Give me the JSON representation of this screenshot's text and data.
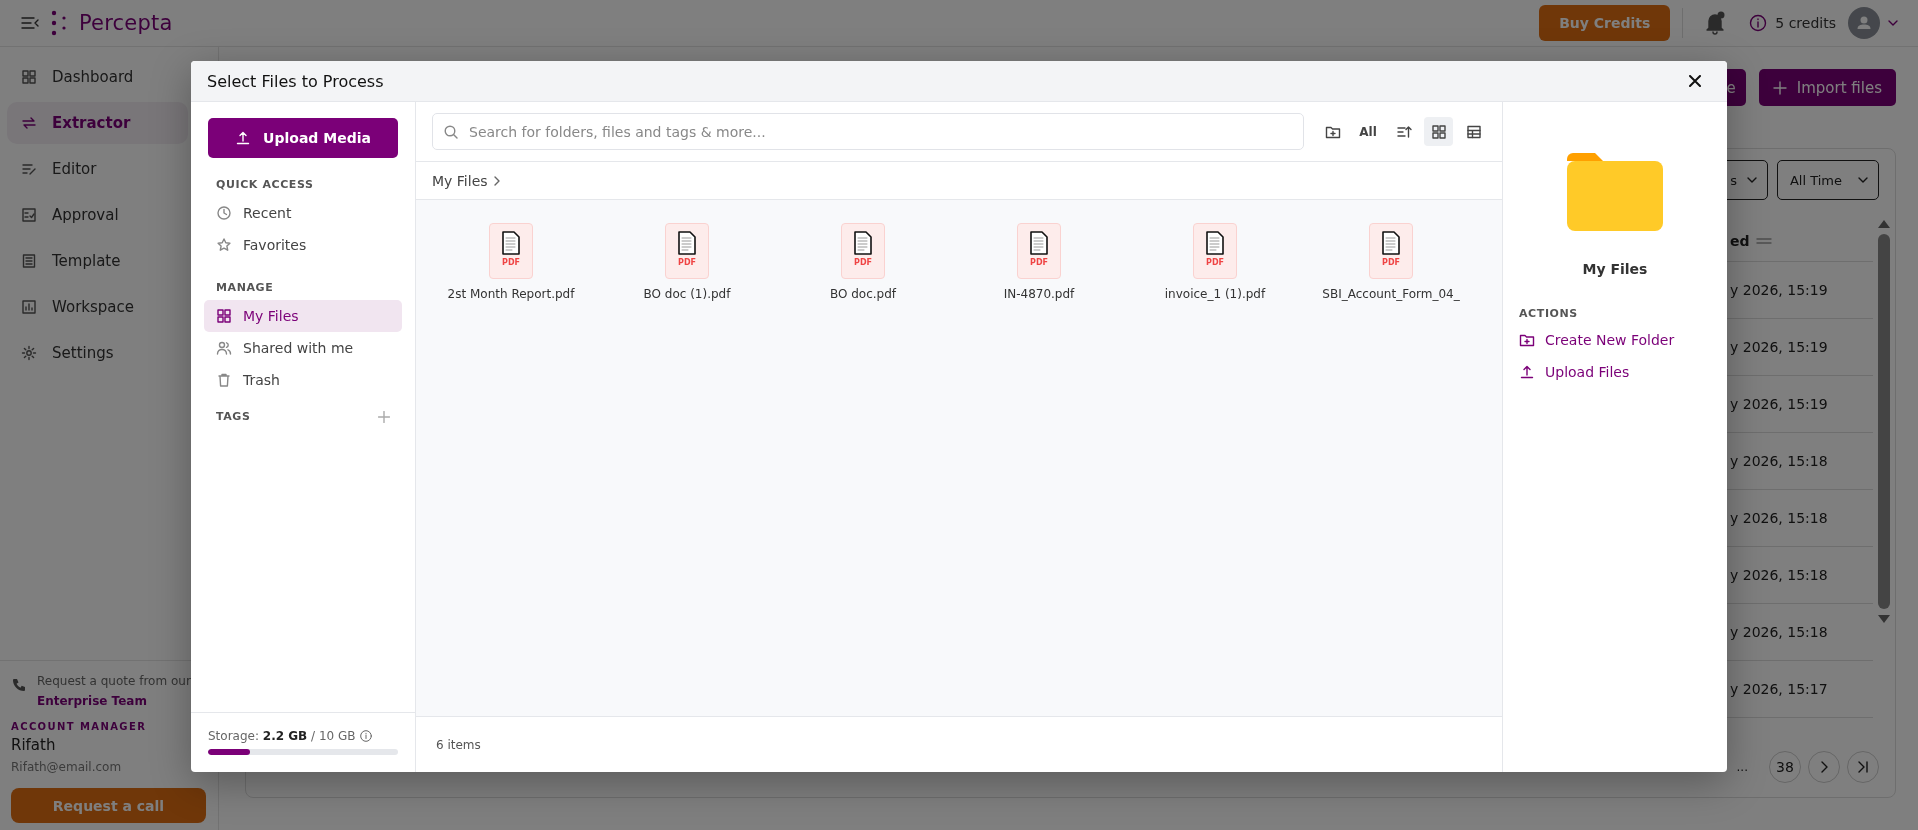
{
  "top_bar": {
    "brand": "Percepta",
    "buy_button": "Buy Credits",
    "credits": "5 credits"
  },
  "sidebar": {
    "items": [
      {
        "label": "Dashboard",
        "selected": false
      },
      {
        "label": "Extractor",
        "selected": true
      },
      {
        "label": "Editor",
        "selected": false
      },
      {
        "label": "Approval",
        "selected": false
      },
      {
        "label": "Template",
        "selected": false
      },
      {
        "label": "Workspace",
        "selected": false
      },
      {
        "label": "Settings",
        "selected": false
      }
    ],
    "quote_text": "Request a quote from our",
    "quote_link": "Enterprise Team",
    "manager_label": "ACCOUNT MANAGER",
    "manager_name": "Rifath",
    "manager_email": "Rifath@email.com",
    "call_button": "Request a call"
  },
  "background_page": {
    "toolbar_buttons": [
      "e",
      "Import files"
    ],
    "filters": [
      "s",
      "All Time"
    ],
    "column_header": "ed",
    "rows": [
      "y 2026, 15:19",
      "y 2026, 15:19",
      "y 2026, 15:19",
      "y 2026, 15:18",
      "y 2026, 15:18",
      "y 2026, 15:18",
      "y 2026, 15:18",
      "y 2026, 15:17"
    ],
    "pagination": [
      "...",
      "38"
    ]
  },
  "dialog": {
    "title": "Select Files to Process",
    "upload_button": "Upload Media",
    "sections": [
      {
        "heading": "QUICK ACCESS",
        "items": [
          {
            "label": "Recent",
            "selected": false
          },
          {
            "label": "Favorites",
            "selected": false
          }
        ]
      },
      {
        "heading": "MANAGE",
        "items": [
          {
            "label": "My Files",
            "selected": true
          },
          {
            "label": "Shared with me",
            "selected": false
          },
          {
            "label": "Trash",
            "selected": false
          }
        ]
      }
    ],
    "tags_heading": "TAGS",
    "storage": {
      "text": "Storage: **2.2 GB** / 10 GB",
      "level": 0.22
    },
    "search": {
      "placeholder": "Search for folders, files and tags & more..."
    },
    "filter_label": "All",
    "view_modes": [
      {
        "kind": "grid",
        "selected": true
      },
      {
        "kind": "table",
        "selected": false
      }
    ],
    "breadcrumb": "My Files",
    "files": [
      {
        "name": "2st Month Report.pdf",
        "badge": "PDF"
      },
      {
        "name": "BO doc (1).pdf",
        "badge": "PDF"
      },
      {
        "name": "BO doc.pdf",
        "badge": "PDF"
      },
      {
        "name": "IN-4870.pdf",
        "badge": "PDF"
      },
      {
        "name": "invoice_1 (1).pdf",
        "badge": "PDF"
      },
      {
        "name": "SBI_Account_Form_04_",
        "badge": "PDF"
      }
    ],
    "item_count": "6 items",
    "details": {
      "title": "My Files",
      "actions_heading": "ACTIONS",
      "actions": [
        {
          "label": "Create New Folder",
          "kind": "folder"
        },
        {
          "label": "Upload Files",
          "kind": "upload"
        }
      ]
    }
  }
}
